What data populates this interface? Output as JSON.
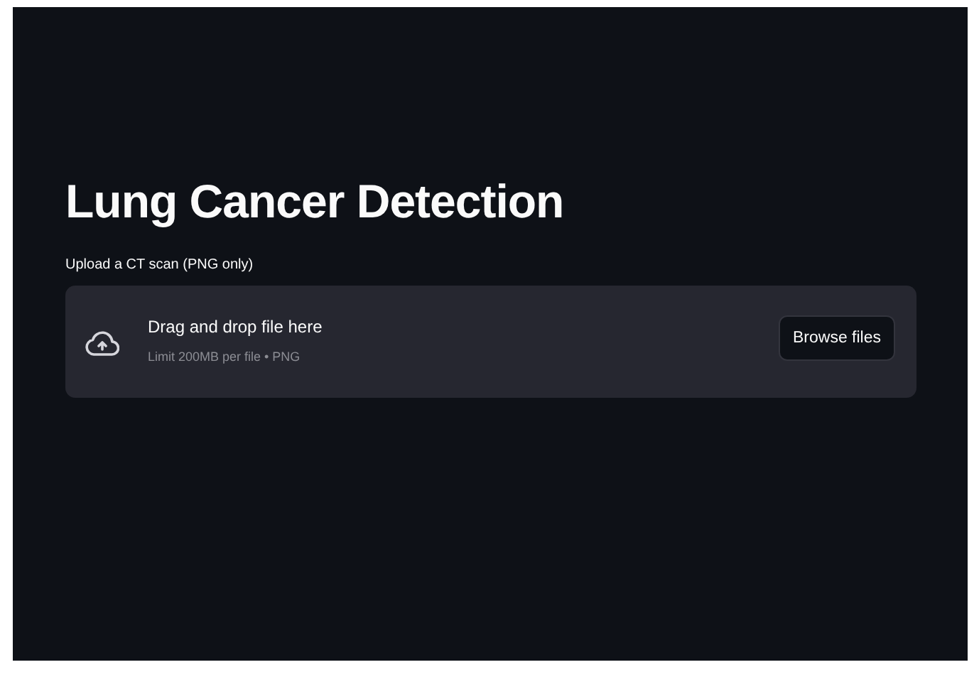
{
  "title": "Lung Cancer Detection",
  "uploader": {
    "label": "Upload a CT scan (PNG only)",
    "instruction": "Drag and drop file here",
    "limit": "Limit 200MB per file • PNG",
    "button": "Browse files"
  }
}
